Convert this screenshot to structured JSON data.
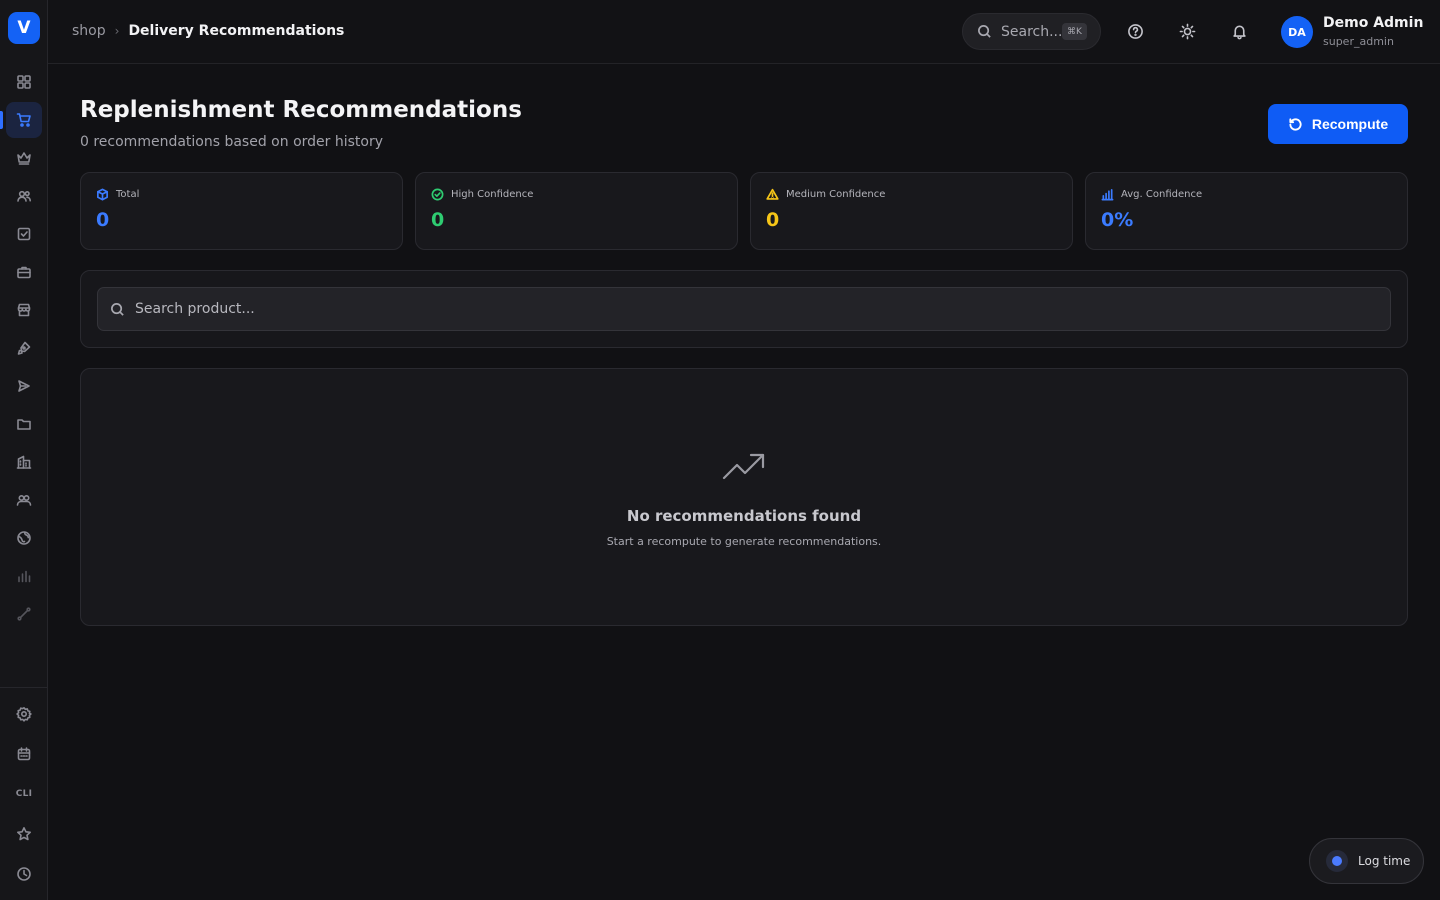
{
  "app": {
    "logo_letter": "V"
  },
  "breadcrumb": {
    "root": "shop",
    "separator": "›",
    "current": "Delivery Recommendations"
  },
  "topbar": {
    "search_label": "Search...",
    "search_shortcut": "⌘K",
    "user": {
      "initials": "DA",
      "name": "Demo Admin",
      "role": "super_admin"
    }
  },
  "header": {
    "title": "Replenishment Recommendations",
    "subtitle": "0 recommendations based on order history",
    "recompute_label": "Recompute"
  },
  "stats": [
    {
      "label": "Total",
      "value": "0",
      "color": "#3b7bff",
      "icon": "cube-icon"
    },
    {
      "label": "High Confidence",
      "value": "0",
      "color": "#2ecc71",
      "icon": "check-circle-icon"
    },
    {
      "label": "Medium Confidence",
      "value": "0",
      "color": "#f5c518",
      "icon": "warning-icon"
    },
    {
      "label": "Avg. Confidence",
      "value": "0%",
      "color": "#3b7bff",
      "icon": "bar-chart-icon"
    }
  ],
  "search": {
    "placeholder": "Search product..."
  },
  "empty_state": {
    "title": "No recommendations found",
    "description": "Start a recompute to generate recommendations."
  },
  "sidebar": {
    "cli_label": "CLI"
  },
  "log_time": {
    "label": "Log time"
  },
  "colors": {
    "accent": "#1462f5",
    "background": "#111114",
    "card": "#18181c"
  }
}
